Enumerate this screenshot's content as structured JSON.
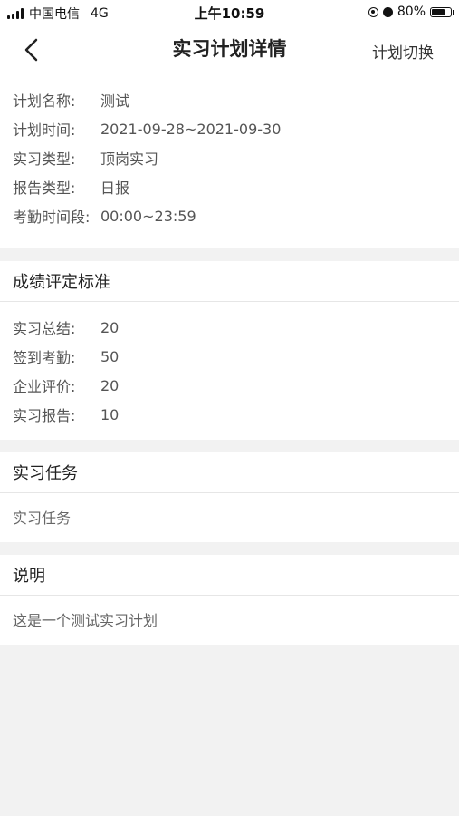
{
  "status_bar": {
    "carrier": "中国电信",
    "network": "4G",
    "time": "上午10:59",
    "battery": "80%",
    "battery_level": 0.8
  },
  "nav": {
    "title": "实习计划详情",
    "switch_label": "计划切换"
  },
  "plan_info": [
    {
      "label": "计划名称:",
      "value": "测试"
    },
    {
      "label": "计划时间:",
      "value": "2021-09-28~2021-09-30"
    },
    {
      "label": "实习类型:",
      "value": "顶岗实习"
    },
    {
      "label": "报告类型:",
      "value": "日报"
    },
    {
      "label": "考勤时间段:",
      "value": "00:00~23:59"
    }
  ],
  "grading": {
    "title": "成绩评定标准",
    "items": [
      {
        "label": "实习总结:",
        "value": "20"
      },
      {
        "label": "签到考勤:",
        "value": "50"
      },
      {
        "label": "企业评价:",
        "value": "20"
      },
      {
        "label": "实习报告:",
        "value": "10"
      }
    ]
  },
  "task": {
    "title": "实习任务",
    "content": "实习任务"
  },
  "description": {
    "title": "说明",
    "content": "这是一个测试实习计划"
  }
}
